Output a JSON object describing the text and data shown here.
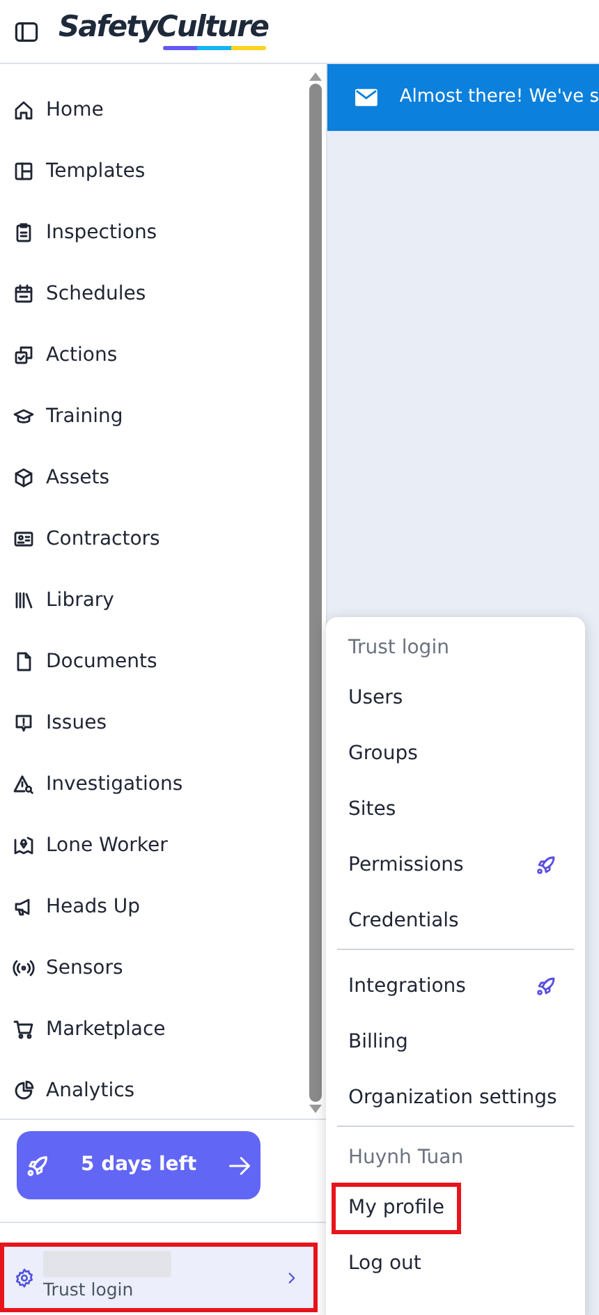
{
  "header": {
    "logo": "SafetyCulture"
  },
  "banner": {
    "text": "Almost there! We've s"
  },
  "sidebar": {
    "items": [
      {
        "label": "Home"
      },
      {
        "label": "Templates"
      },
      {
        "label": "Inspections"
      },
      {
        "label": "Schedules"
      },
      {
        "label": "Actions"
      },
      {
        "label": "Training"
      },
      {
        "label": "Assets"
      },
      {
        "label": "Contractors"
      },
      {
        "label": "Library"
      },
      {
        "label": "Documents"
      },
      {
        "label": "Issues"
      },
      {
        "label": "Investigations"
      },
      {
        "label": "Lone Worker"
      },
      {
        "label": "Heads Up"
      },
      {
        "label": "Sensors"
      },
      {
        "label": "Marketplace"
      },
      {
        "label": "Analytics"
      }
    ],
    "trial_button": "5 days left",
    "footer": {
      "label": "Trust login",
      "highlighted": true
    }
  },
  "menu": {
    "sections": [
      {
        "heading": "Trust login",
        "items": [
          {
            "label": "Users",
            "upgrade": false,
            "highlighted": false
          },
          {
            "label": "Groups",
            "upgrade": false,
            "highlighted": false
          },
          {
            "label": "Sites",
            "upgrade": false,
            "highlighted": false
          },
          {
            "label": "Permissions",
            "upgrade": true,
            "highlighted": false
          },
          {
            "label": "Credentials",
            "upgrade": false,
            "highlighted": false
          }
        ]
      },
      {
        "items": [
          {
            "label": "Integrations",
            "upgrade": true,
            "highlighted": false
          },
          {
            "label": "Billing",
            "upgrade": false,
            "highlighted": false
          },
          {
            "label": "Organization settings",
            "upgrade": false,
            "highlighted": false
          }
        ]
      },
      {
        "heading": "Huynh Tuan",
        "items": [
          {
            "label": "My profile",
            "upgrade": false,
            "highlighted": true
          },
          {
            "label": "Log out",
            "upgrade": false,
            "highlighted": false
          }
        ]
      }
    ]
  }
}
